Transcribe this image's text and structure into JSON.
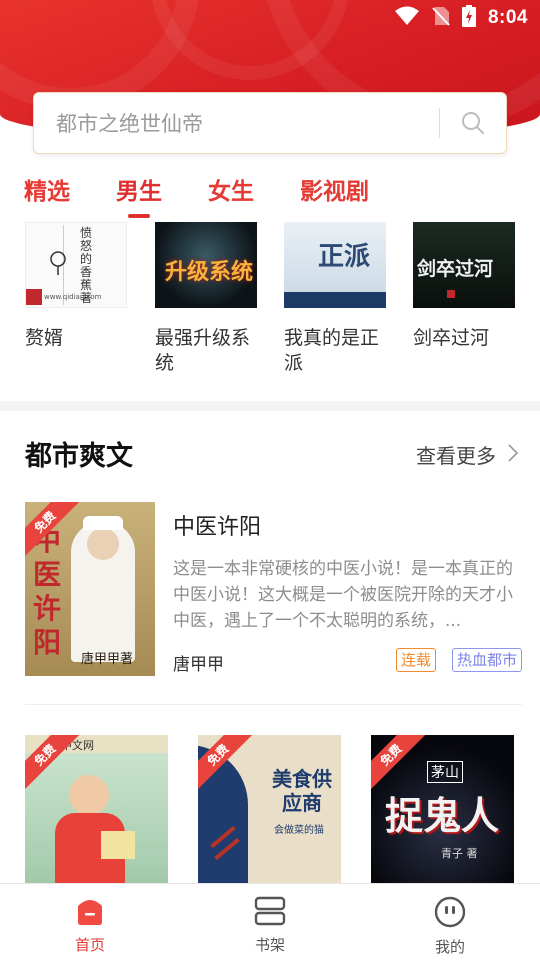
{
  "status_bar": {
    "time": "8:04"
  },
  "search": {
    "placeholder": "都市之绝世仙帝"
  },
  "tabs": [
    {
      "label": "精选"
    },
    {
      "label": "男生"
    },
    {
      "label": "女生"
    },
    {
      "label": "影视剧"
    }
  ],
  "top_books": [
    {
      "title": "赘婿",
      "cover_text": "愤怒的香蕉 著",
      "cover_site": "www.qidian.com"
    },
    {
      "title": "最强升级系统",
      "cover_text": "升级系统"
    },
    {
      "title": "我真的是正派",
      "cover_text": "正派"
    },
    {
      "title": "剑卒过河",
      "cover_text": "剑卒过河"
    }
  ],
  "section": {
    "title": "都市爽文",
    "more_label": "查看更多"
  },
  "featured": {
    "title": "中医许阳",
    "description": "这是一本非常硬核的中医小说！是一本真正的中医小说！这大概是一个被医院开除的天才小中医，遇上了一个不太聪明的系统，...",
    "author": "唐甲甲",
    "tags": [
      "连载",
      "热血都市"
    ],
    "badge": "免费",
    "cover_title": "中医许阳",
    "cover_author": "唐甲甲著"
  },
  "more_books": [
    {
      "badge": "免费",
      "cover_text": "中文网"
    },
    {
      "badge": "免费",
      "cover_text": "美食供应商",
      "cover_author": "会做菜的猫"
    },
    {
      "badge": "免费",
      "cover_text": "捉鬼人",
      "cover_series": "茅山",
      "cover_author": "青子 著"
    }
  ],
  "bottom_nav": [
    {
      "label": "首页"
    },
    {
      "label": "书架"
    },
    {
      "label": "我的"
    }
  ],
  "colors": {
    "brand": "#e02f2f",
    "tag_orange": "#f28a2e",
    "tag_purple": "#7d84e8"
  }
}
